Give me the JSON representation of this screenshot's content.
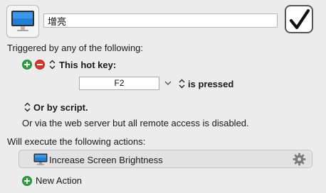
{
  "macro": {
    "name": "增亮",
    "enabled": true
  },
  "trigger": {
    "heading": "Triggered by any of the following:",
    "hotkey_label": "This hot key:",
    "hotkey_value": "F2",
    "hotkey_mode": "is pressed",
    "script_label": "Or by script.",
    "web_server_note": "Or via the web server but all remote access is disabled."
  },
  "actions": {
    "heading": "Will execute the following actions:",
    "items": [
      {
        "label": "Increase Screen Brightness",
        "icon": "monitor-icon"
      }
    ],
    "new_action_label": "New Action"
  },
  "colors": {
    "add": "#29a43a",
    "remove": "#d9342b",
    "background": "#ececec"
  }
}
